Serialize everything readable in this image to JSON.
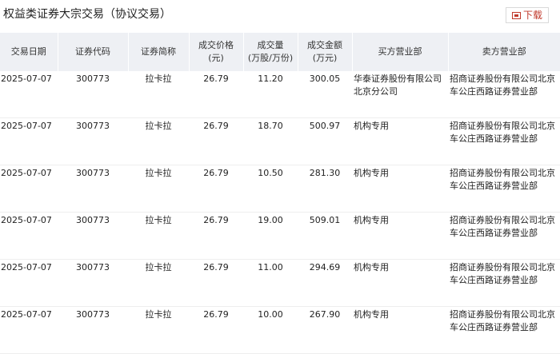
{
  "header": {
    "title": "权益类证券大宗交易（协议交易）",
    "download_label": "下载",
    "download_icon": "download-icon"
  },
  "colors": {
    "accent": "#c0392b",
    "header_bg": "#eef0f4"
  },
  "table": {
    "columns": [
      "交易日期",
      "证券代码",
      "证券简称",
      "成交价格\n(元)",
      "成交量\n(万股/万份)",
      "成交金额\n(万元)",
      "买方营业部",
      "卖方营业部"
    ],
    "rows": [
      [
        "2025-07-07",
        "300773",
        "拉卡拉",
        "26.79",
        "11.20",
        "300.05",
        "华泰证券股份有限公司北京分公司",
        "招商证券股份有限公司北京车公庄西路证券营业部"
      ],
      [
        "2025-07-07",
        "300773",
        "拉卡拉",
        "26.79",
        "18.70",
        "500.97",
        "机构专用",
        "招商证券股份有限公司北京车公庄西路证券营业部"
      ],
      [
        "2025-07-07",
        "300773",
        "拉卡拉",
        "26.79",
        "10.50",
        "281.30",
        "机构专用",
        "招商证券股份有限公司北京车公庄西路证券营业部"
      ],
      [
        "2025-07-07",
        "300773",
        "拉卡拉",
        "26.79",
        "19.00",
        "509.01",
        "机构专用",
        "招商证券股份有限公司北京车公庄西路证券营业部"
      ],
      [
        "2025-07-07",
        "300773",
        "拉卡拉",
        "26.79",
        "11.00",
        "294.69",
        "机构专用",
        "招商证券股份有限公司北京车公庄西路证券营业部"
      ],
      [
        "2025-07-07",
        "300773",
        "拉卡拉",
        "26.79",
        "10.00",
        "267.90",
        "机构专用",
        "招商证券股份有限公司北京车公庄西路证券营业部"
      ]
    ]
  }
}
